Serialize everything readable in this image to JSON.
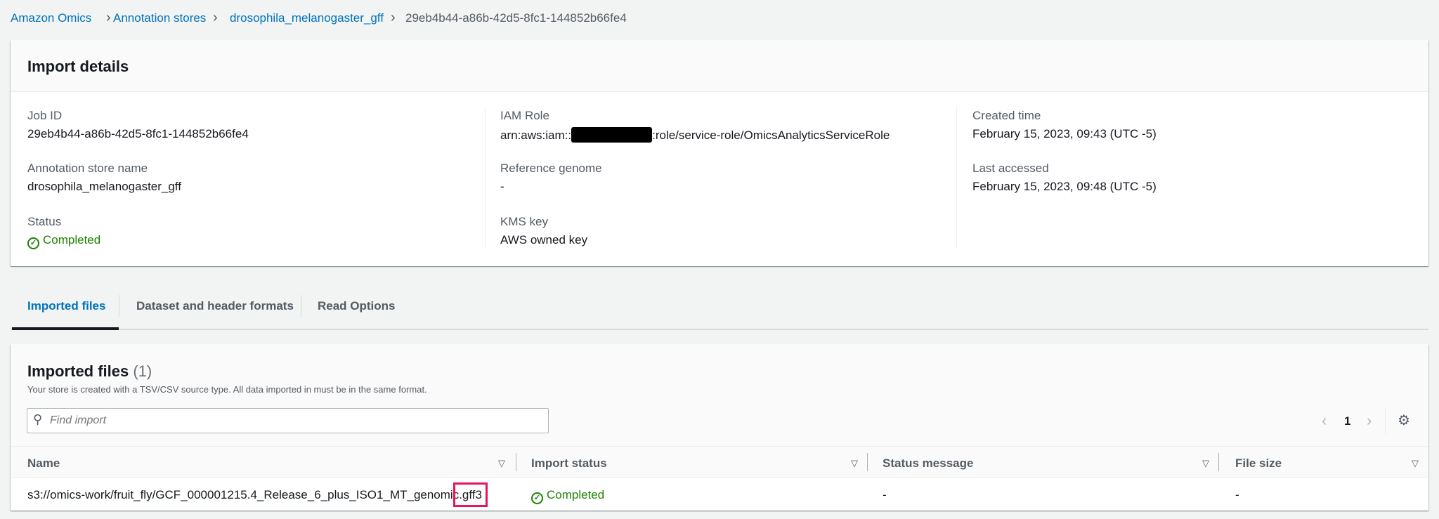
{
  "breadcrumb": [
    "Amazon Omics",
    "Annotation stores",
    "drosophila_melanogaster_gff",
    "29eb4b44-a86b-42d5-8fc1-144852b66fe4"
  ],
  "details": {
    "title": "Import details",
    "job_id_label": "Job ID",
    "job_id": "29eb4b44-a86b-42d5-8fc1-144852b66fe4",
    "store_label": "Annotation store name",
    "store": "drosophila_melanogaster_gff",
    "status_label": "Status",
    "status": "Completed",
    "iam_label": "IAM Role",
    "iam_prefix": "arn:aws:iam::",
    "iam_suffix": ":role/service-role/OmicsAnalyticsServiceRole",
    "ref_label": "Reference genome",
    "ref": "-",
    "kms_label": "KMS key",
    "kms": "AWS owned key",
    "created_label": "Created time",
    "created": "February 15, 2023, 09:43 (UTC -5)",
    "accessed_label": "Last accessed",
    "accessed": "February 15, 2023, 09:48 (UTC -5)"
  },
  "tabs": [
    "Imported files",
    "Dataset and header formats",
    "Read Options"
  ],
  "files": {
    "title": "Imported files",
    "count": "(1)",
    "description": "Your store is created with a TSV/CSV source type. All data imported in must be in the same format.",
    "search_placeholder": "Find import",
    "page": "1",
    "columns": [
      "Name",
      "Import status",
      "Status message",
      "File size"
    ],
    "rows": [
      {
        "name_main": "s3://omics-work/fruit_fly/GCF_000001215.4_Release_6_plus_ISO1_MT_genomic",
        "name_ext": ".gff3",
        "status": "Completed",
        "message": "-",
        "size": "-"
      }
    ]
  },
  "colors": {
    "link": "#0073bb",
    "success": "#1d8102",
    "highlight": "#e7155b"
  }
}
